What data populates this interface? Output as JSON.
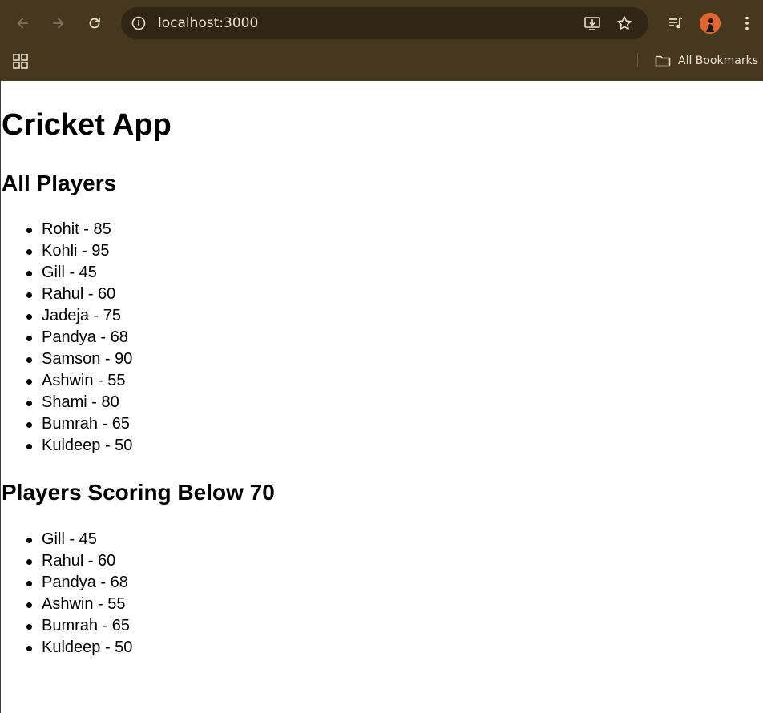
{
  "browser": {
    "url": "localhost:3000",
    "bookmarks_label": "All Bookmarks",
    "icons": {
      "back": "arrow-left-icon",
      "forward": "arrow-right-icon",
      "reload": "reload-icon",
      "site_info": "info-icon",
      "install": "install-app-icon",
      "bookmark_star": "star-icon",
      "media": "media-queue-icon",
      "menu": "kebab-menu-icon",
      "apps": "apps-grid-icon",
      "folder": "folder-icon"
    },
    "colors": {
      "frame": "#46381f",
      "omnibox": "#2f2616",
      "avatar": "#e0652e"
    }
  },
  "page": {
    "title": "Cricket App",
    "all_players": {
      "heading": "All Players",
      "items": [
        "Rohit - 85",
        "Kohli - 95",
        "Gill - 45",
        "Rahul - 60",
        "Jadeja - 75",
        "Pandya - 68",
        "Samson - 90",
        "Ashwin - 55",
        "Shami - 80",
        "Bumrah - 65",
        "Kuldeep - 50"
      ]
    },
    "below_70": {
      "heading": "Players Scoring Below 70",
      "items": [
        "Gill - 45",
        "Rahul - 60",
        "Pandya - 68",
        "Ashwin - 55",
        "Bumrah - 65",
        "Kuldeep - 50"
      ]
    }
  }
}
